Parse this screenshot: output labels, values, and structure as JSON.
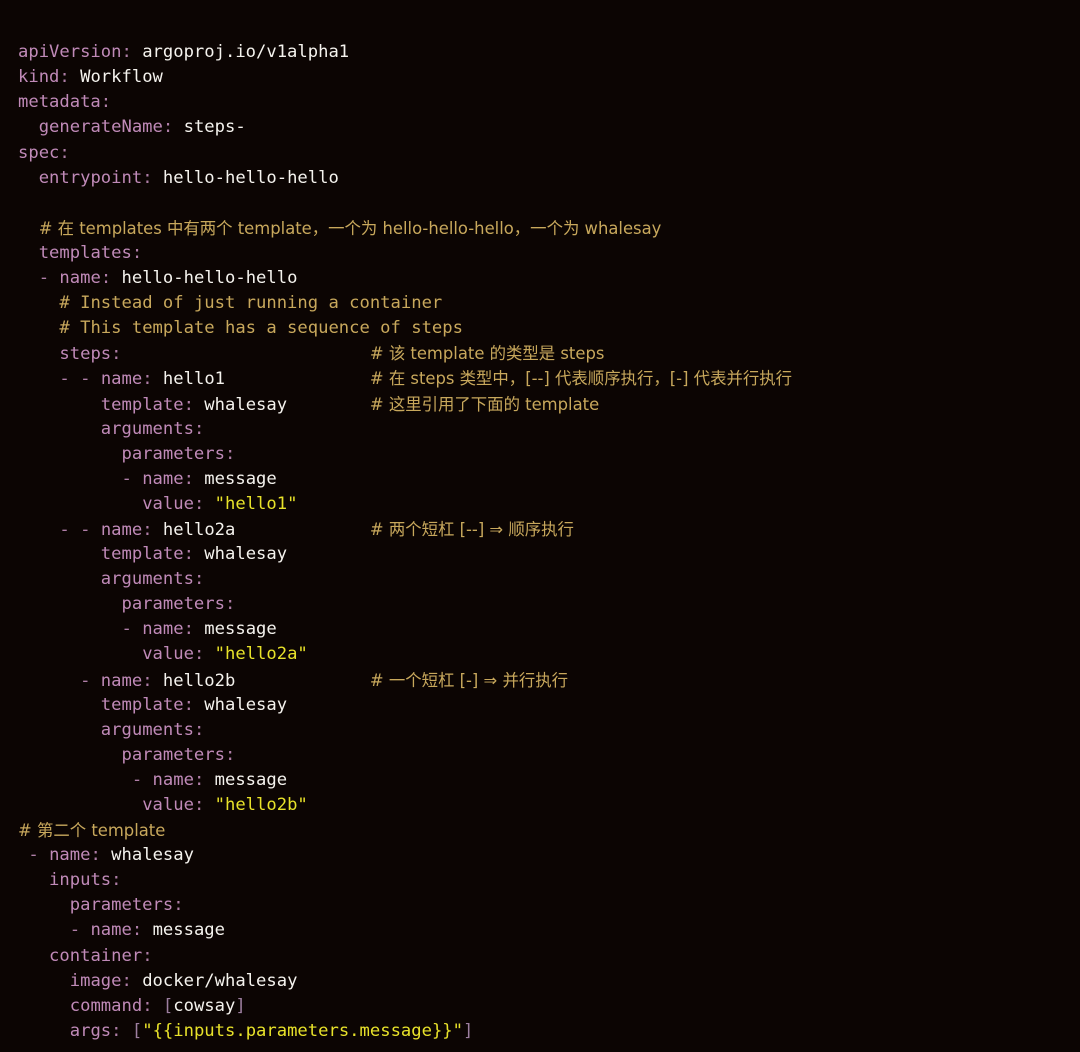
{
  "editor": {
    "language": "yaml",
    "background_color": "#0c0503",
    "theme_colors": {
      "key": "#c08ab8",
      "value": "#f5f3ee",
      "string": "#e8e22a",
      "comment": "#c8a85c",
      "punctuation": "#b07fa8"
    }
  },
  "document": {
    "kind": "Argo Workflow manifest",
    "lines": [
      {
        "n": 1,
        "indent": 0,
        "tokens": [
          {
            "t": "key",
            "v": "apiVersion"
          },
          {
            "t": "punct",
            "v": ": "
          },
          {
            "t": "val",
            "v": "argoproj.io/v1alpha1"
          }
        ]
      },
      {
        "n": 2,
        "indent": 0,
        "tokens": [
          {
            "t": "key",
            "v": "kind"
          },
          {
            "t": "punct",
            "v": ": "
          },
          {
            "t": "val",
            "v": "Workflow"
          }
        ]
      },
      {
        "n": 3,
        "indent": 0,
        "tokens": [
          {
            "t": "key",
            "v": "metadata"
          },
          {
            "t": "punct",
            "v": ":"
          }
        ]
      },
      {
        "n": 4,
        "indent": 2,
        "tokens": [
          {
            "t": "key",
            "v": "generateName"
          },
          {
            "t": "punct",
            "v": ": "
          },
          {
            "t": "val",
            "v": "steps-"
          }
        ]
      },
      {
        "n": 5,
        "indent": 0,
        "tokens": [
          {
            "t": "key",
            "v": "spec"
          },
          {
            "t": "punct",
            "v": ":"
          }
        ]
      },
      {
        "n": 6,
        "indent": 2,
        "tokens": [
          {
            "t": "key",
            "v": "entrypoint"
          },
          {
            "t": "punct",
            "v": ": "
          },
          {
            "t": "val",
            "v": "hello-hello-hello"
          }
        ]
      },
      {
        "n": 7,
        "indent": 0,
        "tokens": []
      },
      {
        "n": 8,
        "indent": 2,
        "tokens": [
          {
            "t": "comment",
            "v": "# 在 templates 中有两个 template，一个为 hello-hello-hello，一个为 whalesay"
          }
        ]
      },
      {
        "n": 9,
        "indent": 2,
        "tokens": [
          {
            "t": "key",
            "v": "templates"
          },
          {
            "t": "punct",
            "v": ":"
          }
        ]
      },
      {
        "n": 10,
        "indent": 2,
        "tokens": [
          {
            "t": "dash",
            "v": "- "
          },
          {
            "t": "key",
            "v": "name"
          },
          {
            "t": "punct",
            "v": ": "
          },
          {
            "t": "val",
            "v": "hello-hello-hello"
          }
        ]
      },
      {
        "n": 11,
        "indent": 4,
        "tokens": [
          {
            "t": "comment",
            "v": "# Instead of just running a container"
          }
        ]
      },
      {
        "n": 12,
        "indent": 4,
        "tokens": [
          {
            "t": "comment",
            "v": "# This template has a sequence of steps"
          }
        ]
      },
      {
        "n": 13,
        "indent": 4,
        "tokens": [
          {
            "t": "key",
            "v": "steps"
          },
          {
            "t": "punct",
            "v": ":"
          }
        ],
        "comment": "# 该 template 的类型是 steps"
      },
      {
        "n": 14,
        "indent": 4,
        "tokens": [
          {
            "t": "dash",
            "v": "- - "
          },
          {
            "t": "key",
            "v": "name"
          },
          {
            "t": "punct",
            "v": ": "
          },
          {
            "t": "val",
            "v": "hello1"
          }
        ],
        "comment": "# 在 steps 类型中，[--] 代表顺序执行，[-] 代表并行执行"
      },
      {
        "n": 15,
        "indent": 8,
        "tokens": [
          {
            "t": "key",
            "v": "template"
          },
          {
            "t": "punct",
            "v": ": "
          },
          {
            "t": "val",
            "v": "whalesay"
          }
        ],
        "comment": "# 这里引用了下面的 template"
      },
      {
        "n": 16,
        "indent": 8,
        "tokens": [
          {
            "t": "key",
            "v": "arguments"
          },
          {
            "t": "punct",
            "v": ":"
          }
        ]
      },
      {
        "n": 17,
        "indent": 10,
        "tokens": [
          {
            "t": "key",
            "v": "parameters"
          },
          {
            "t": "punct",
            "v": ":"
          }
        ]
      },
      {
        "n": 18,
        "indent": 10,
        "tokens": [
          {
            "t": "dash",
            "v": "- "
          },
          {
            "t": "key",
            "v": "name"
          },
          {
            "t": "punct",
            "v": ": "
          },
          {
            "t": "val",
            "v": "message"
          }
        ]
      },
      {
        "n": 19,
        "indent": 12,
        "tokens": [
          {
            "t": "key",
            "v": "value"
          },
          {
            "t": "punct",
            "v": ": "
          },
          {
            "t": "str",
            "v": "\"hello1\""
          }
        ]
      },
      {
        "n": 20,
        "indent": 4,
        "tokens": [
          {
            "t": "dash",
            "v": "- - "
          },
          {
            "t": "key",
            "v": "name"
          },
          {
            "t": "punct",
            "v": ": "
          },
          {
            "t": "val",
            "v": "hello2a"
          }
        ],
        "comment": "# 两个短杠 [--] ⇒ 顺序执行"
      },
      {
        "n": 21,
        "indent": 8,
        "tokens": [
          {
            "t": "key",
            "v": "template"
          },
          {
            "t": "punct",
            "v": ": "
          },
          {
            "t": "val",
            "v": "whalesay"
          }
        ]
      },
      {
        "n": 22,
        "indent": 8,
        "tokens": [
          {
            "t": "key",
            "v": "arguments"
          },
          {
            "t": "punct",
            "v": ":"
          }
        ]
      },
      {
        "n": 23,
        "indent": 10,
        "tokens": [
          {
            "t": "key",
            "v": "parameters"
          },
          {
            "t": "punct",
            "v": ":"
          }
        ]
      },
      {
        "n": 24,
        "indent": 10,
        "tokens": [
          {
            "t": "dash",
            "v": "- "
          },
          {
            "t": "key",
            "v": "name"
          },
          {
            "t": "punct",
            "v": ": "
          },
          {
            "t": "val",
            "v": "message"
          }
        ]
      },
      {
        "n": 25,
        "indent": 12,
        "tokens": [
          {
            "t": "key",
            "v": "value"
          },
          {
            "t": "punct",
            "v": ": "
          },
          {
            "t": "str",
            "v": "\"hello2a\""
          }
        ]
      },
      {
        "n": 26,
        "indent": 6,
        "tokens": [
          {
            "t": "dash",
            "v": "- "
          },
          {
            "t": "key",
            "v": "name"
          },
          {
            "t": "punct",
            "v": ": "
          },
          {
            "t": "val",
            "v": "hello2b"
          }
        ],
        "comment": "# 一个短杠 [-] ⇒ 并行执行"
      },
      {
        "n": 27,
        "indent": 8,
        "tokens": [
          {
            "t": "key",
            "v": "template"
          },
          {
            "t": "punct",
            "v": ": "
          },
          {
            "t": "val",
            "v": "whalesay"
          }
        ]
      },
      {
        "n": 28,
        "indent": 8,
        "tokens": [
          {
            "t": "key",
            "v": "arguments"
          },
          {
            "t": "punct",
            "v": ":"
          }
        ]
      },
      {
        "n": 29,
        "indent": 10,
        "tokens": [
          {
            "t": "key",
            "v": "parameters"
          },
          {
            "t": "punct",
            "v": ":"
          }
        ]
      },
      {
        "n": 30,
        "indent": 11,
        "tokens": [
          {
            "t": "dash",
            "v": "- "
          },
          {
            "t": "key",
            "v": "name"
          },
          {
            "t": "punct",
            "v": ": "
          },
          {
            "t": "val",
            "v": "message"
          }
        ]
      },
      {
        "n": 31,
        "indent": 12,
        "tokens": [
          {
            "t": "key",
            "v": "value"
          },
          {
            "t": "punct",
            "v": ": "
          },
          {
            "t": "str",
            "v": "\"hello2b\""
          }
        ]
      },
      {
        "n": 32,
        "indent": -1,
        "tokens": [
          {
            "t": "comment",
            "v": "# 第二个 template"
          }
        ]
      },
      {
        "n": 33,
        "indent": 1,
        "tokens": [
          {
            "t": "dash",
            "v": "- "
          },
          {
            "t": "key",
            "v": "name"
          },
          {
            "t": "punct",
            "v": ": "
          },
          {
            "t": "val",
            "v": "whalesay"
          }
        ]
      },
      {
        "n": 34,
        "indent": 3,
        "tokens": [
          {
            "t": "key",
            "v": "inputs"
          },
          {
            "t": "punct",
            "v": ":"
          }
        ]
      },
      {
        "n": 35,
        "indent": 5,
        "tokens": [
          {
            "t": "key",
            "v": "parameters"
          },
          {
            "t": "punct",
            "v": ":"
          }
        ]
      },
      {
        "n": 36,
        "indent": 5,
        "tokens": [
          {
            "t": "dash",
            "v": "- "
          },
          {
            "t": "key",
            "v": "name"
          },
          {
            "t": "punct",
            "v": ": "
          },
          {
            "t": "val",
            "v": "message"
          }
        ]
      },
      {
        "n": 37,
        "indent": 3,
        "tokens": [
          {
            "t": "key",
            "v": "container"
          },
          {
            "t": "punct",
            "v": ":"
          }
        ]
      },
      {
        "n": 38,
        "indent": 5,
        "tokens": [
          {
            "t": "key",
            "v": "image"
          },
          {
            "t": "punct",
            "v": ": "
          },
          {
            "t": "val",
            "v": "docker/whalesay"
          }
        ]
      },
      {
        "n": 39,
        "indent": 5,
        "tokens": [
          {
            "t": "key",
            "v": "command"
          },
          {
            "t": "punct",
            "v": ": "
          },
          {
            "t": "bracket",
            "v": "["
          },
          {
            "t": "val",
            "v": "cowsay"
          },
          {
            "t": "bracket",
            "v": "]"
          }
        ]
      },
      {
        "n": 40,
        "indent": 5,
        "tokens": [
          {
            "t": "key",
            "v": "args"
          },
          {
            "t": "punct",
            "v": ": "
          },
          {
            "t": "bracket",
            "v": "["
          },
          {
            "t": "str",
            "v": "\"{{inputs.parameters.message}}\""
          },
          {
            "t": "bracket",
            "v": "]"
          }
        ]
      }
    ],
    "comment_column": 34
  }
}
